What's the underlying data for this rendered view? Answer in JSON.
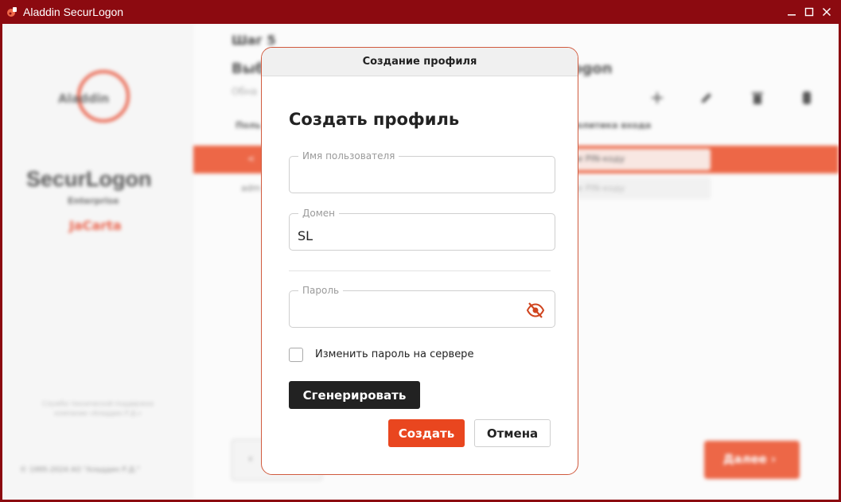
{
  "window": {
    "title": "Aladdin SecurLogon",
    "controls": [
      "minimize",
      "maximize",
      "close"
    ]
  },
  "background": {
    "sidebar": {
      "logo_text": "Aladdin",
      "brand": "SecurLogon",
      "brand_sub": "Enterprise",
      "brand_product": "JaCarta",
      "note": "Служба технической поддержки компании «Аладдин Р.Д.»",
      "copyright": "© 1995-2024 АО \"Аладдин Р.Д.\""
    },
    "main": {
      "step": "Шаг 5",
      "heading_left": "Выб",
      "heading_right": "logon",
      "subtitle": "Обна",
      "columns": [
        "Поль",
        "Политика входа"
      ],
      "rows": [
        {
          "user": "<",
          "policy": "ли PIN-коду"
        },
        {
          "user": "adm",
          "policy": "ли PIN-коду"
        }
      ],
      "back_label": "‹",
      "next_label": "Далее ›"
    }
  },
  "dialog": {
    "title": "Создание профиля",
    "heading": "Создать профиль",
    "username": {
      "label": "Имя пользователя",
      "value": ""
    },
    "domain": {
      "label": "Домен",
      "value": "SL"
    },
    "password": {
      "label": "Пароль",
      "value": ""
    },
    "change_password_label": "Изменить пароль на сервере",
    "change_password_checked": false,
    "generate_label": "Сгенерировать",
    "create_label": "Создать",
    "cancel_label": "Отмена",
    "eye_icon": "eye-off-icon",
    "accent_color": "#e9461f",
    "dark_color": "#222222"
  }
}
